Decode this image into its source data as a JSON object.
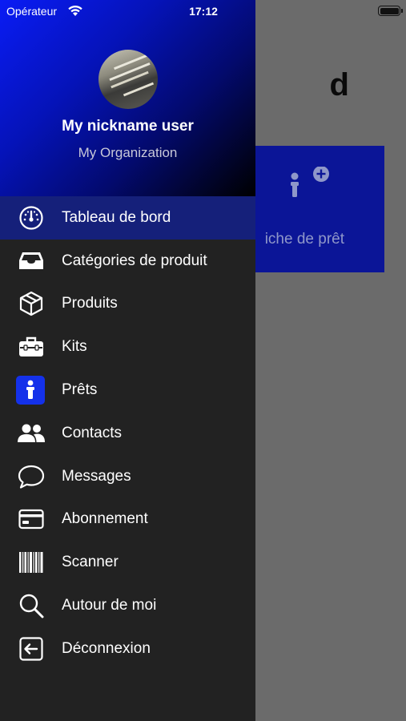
{
  "status_bar": {
    "carrier": "Opérateur",
    "time": "17:12"
  },
  "background_page": {
    "title_fragment": "d",
    "card_label": "iche de prêt",
    "card_color": "#0b1597"
  },
  "drawer": {
    "user_name": "My nickname user",
    "organization": "My Organization",
    "header_gradient": [
      "#0a1cf5",
      "#000000"
    ],
    "items": [
      {
        "label": "Tableau de bord",
        "icon": "dashboard-gauge-icon",
        "active": true
      },
      {
        "label": "Catégories de produit",
        "icon": "inbox-tray-icon",
        "active": false
      },
      {
        "label": "Produits",
        "icon": "box-cube-icon",
        "active": false
      },
      {
        "label": "Kits",
        "icon": "toolbox-icon",
        "active": false
      },
      {
        "label": "Prêts",
        "icon": "info-icon",
        "active": false
      },
      {
        "label": "Contacts",
        "icon": "people-icon",
        "active": false
      },
      {
        "label": "Messages",
        "icon": "chat-bubble-icon",
        "active": false
      },
      {
        "label": "Abonnement",
        "icon": "credit-card-icon",
        "active": false
      },
      {
        "label": "Scanner",
        "icon": "barcode-icon",
        "active": false
      },
      {
        "label": "Autour de moi",
        "icon": "magnifier-icon",
        "active": false
      },
      {
        "label": "Déconnexion",
        "icon": "logout-icon",
        "active": false
      }
    ]
  }
}
